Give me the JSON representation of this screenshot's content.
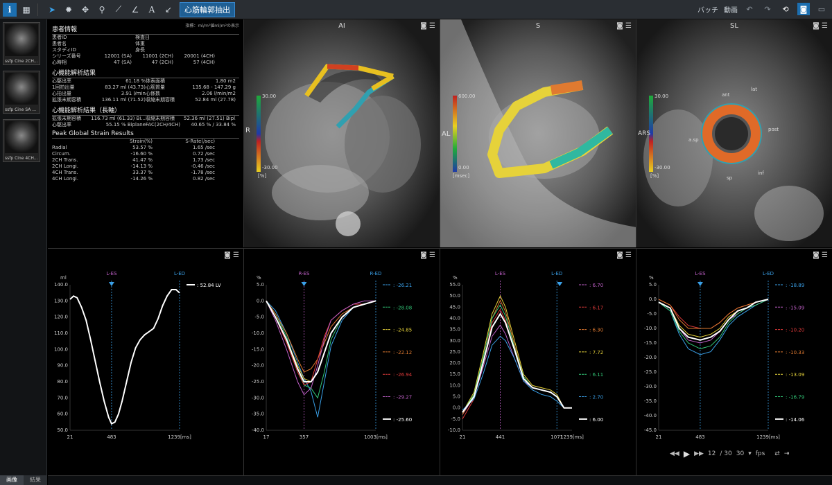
{
  "toolbar": {
    "mode_label": "心筋輪郭抽出",
    "right_labels": [
      "バッチ",
      "動画"
    ]
  },
  "thumbnails": [
    {
      "caption": "ssfp Cine 2CH..."
    },
    {
      "caption": "ssfp Cine SA ..."
    },
    {
      "caption": "ssfp Cine 4CH..."
    }
  ],
  "thumb_tabs": [
    "画像",
    "結果"
  ],
  "info": {
    "title": "患者情報",
    "note": "指標：ml/m²値ml/m²の表示",
    "patient_rows": [
      [
        "患者ID",
        "",
        "検査日",
        ""
      ],
      [
        "患者名",
        "",
        "体重",
        ""
      ],
      [
        "スタディID",
        "",
        "身長",
        ""
      ]
    ],
    "series_row": [
      "シリーズ番号",
      "12001 (SA)",
      "11001 (2CH)",
      "20001 (4CH)"
    ],
    "phase_row": [
      "心時相",
      "47 (SA)",
      "47 (2CH)",
      "57 (4CH)"
    ],
    "cardiac_title": "心機能解析結果",
    "cardiac_rows": [
      [
        "心駆出率",
        "61.18 %",
        "体表面積",
        "1.80 m2"
      ],
      [
        "1回拍出量",
        "83.27 ml (43.73)",
        "心筋質量",
        "135.68 - 147.29 g"
      ],
      [
        "心拍出量",
        "3.91 l/min",
        "心係数",
        "2.06 l/min/m2"
      ],
      [
        "拡張末期容積",
        "136.11 ml (71.52)",
        "収縮末期容積",
        "52.84 ml (27.78)"
      ]
    ],
    "long_title": "心機能解析結果（長軸）",
    "long_rows": [
      [
        "拡張末期容積",
        "116.73 ml (61.33) Bi...",
        "収縮末期容積",
        "52.36 ml (27.51) Bipl..."
      ],
      [
        "心駆出率",
        "55.15 % Biplane",
        "FAC(2CH/4CH)",
        "40.65 % / 33.84 %"
      ]
    ],
    "strain_title": "Peak Global Strain Results",
    "strain_headers": [
      "",
      "Strain(%)",
      "S-Rate(/sec)"
    ],
    "strain_rows": [
      [
        "Radial",
        "53.57 %",
        "1.65 /sec"
      ],
      [
        "Circum.",
        "-16.60 %",
        "0.72 /sec"
      ],
      [
        "2CH Trans.",
        "41.47 %",
        "1.73 /sec"
      ],
      [
        "2CH Longi.",
        "-14.13 %",
        "-0.46 /sec"
      ],
      [
        "4CH Trans.",
        "33.37 %",
        "-1.78 /sec"
      ],
      [
        "4CH Longi.",
        "-14.26 %",
        "0.82 /sec"
      ]
    ]
  },
  "viewports": [
    {
      "title": "AI",
      "axis_label": "R",
      "scale_top": "30.00",
      "scale_bottom": "-30.00",
      "unit": "[%]"
    },
    {
      "title": "S",
      "axis_label": "AL",
      "scale_top": "600.00",
      "scale_bottom": "0.00",
      "unit": "[msec]"
    },
    {
      "title": "SL",
      "axis_label": "ARS",
      "scale_top": "30.00",
      "scale_bottom": "-30.00",
      "unit": "[%]",
      "segments": [
        "ant",
        "lat",
        "post",
        "inf",
        "sp",
        "a.sp"
      ]
    }
  ],
  "chart_data": [
    {
      "type": "line",
      "ylabel": "ml",
      "ylim": [
        50,
        140
      ],
      "yticks": [
        "140.0",
        "130.0",
        "120.0",
        "110.0",
        "100.0",
        "90.0",
        "80.0",
        "70.0",
        "60.0",
        "50.0"
      ],
      "xticks": [
        "21",
        "483",
        "1239[ms]"
      ],
      "markers": [
        "L-ES",
        "L-ED"
      ],
      "series": [
        {
          "name": ": 52.84 LV",
          "color": "#ffffff",
          "x": [
            21,
            60,
            100,
            150,
            200,
            250,
            300,
            350,
            400,
            450,
            483,
            520,
            560,
            600,
            650,
            700,
            750,
            800,
            850,
            900,
            950,
            1000,
            1050,
            1100,
            1150,
            1200,
            1239
          ],
          "y": [
            131,
            133,
            132,
            126,
            118,
            106,
            93,
            80,
            68,
            58,
            54,
            55,
            60,
            68,
            80,
            92,
            101,
            106,
            109,
            111,
            113,
            119,
            127,
            133,
            137,
            137,
            135
          ]
        }
      ]
    },
    {
      "type": "line",
      "ylabel": "%",
      "ylim": [
        -40,
        5
      ],
      "yticks": [
        "5.0",
        "0.0",
        "-5.0",
        "-10.0",
        "-15.0",
        "-20.0",
        "-25.0",
        "-30.0",
        "-35.0",
        "-40.0"
      ],
      "xticks": [
        "17",
        "357",
        "1003[ms]"
      ],
      "markers": [
        "R-ES",
        "R-ED"
      ],
      "series": [
        {
          "name": ": -26.21",
          "color": "#3aa0e8",
          "x": [
            17,
            100,
            200,
            300,
            357,
            420,
            480,
            540,
            600,
            700,
            800,
            900,
            1003
          ],
          "y": [
            0,
            -3,
            -10,
            -19,
            -24,
            -28,
            -36,
            -25,
            -14,
            -6,
            -2,
            -1,
            0
          ]
        },
        {
          "name": ": -28.08",
          "color": "#32c878",
          "x": [
            17,
            100,
            200,
            300,
            357,
            420,
            480,
            540,
            600,
            700,
            800,
            900,
            1003
          ],
          "y": [
            0,
            -4,
            -11,
            -21,
            -26,
            -27,
            -30,
            -22,
            -12,
            -5,
            -2,
            -1,
            0
          ]
        },
        {
          "name": ": -24.85",
          "color": "#e6d23a",
          "x": [
            17,
            100,
            200,
            300,
            357,
            420,
            480,
            540,
            600,
            700,
            800,
            900,
            1003
          ],
          "y": [
            0,
            -5,
            -12,
            -20,
            -24,
            -25,
            -22,
            -16,
            -10,
            -5,
            -2,
            -1,
            0
          ]
        },
        {
          "name": ": -22.12",
          "color": "#e07a30",
          "x": [
            17,
            100,
            200,
            300,
            357,
            420,
            480,
            540,
            600,
            700,
            800,
            900,
            1003
          ],
          "y": [
            0,
            -4,
            -10,
            -18,
            -22,
            -21,
            -18,
            -13,
            -8,
            -4,
            -2,
            -1,
            0
          ]
        },
        {
          "name": ": -26.94",
          "color": "#e03a3a",
          "x": [
            17,
            100,
            200,
            300,
            357,
            420,
            480,
            540,
            600,
            700,
            800,
            900,
            1003
          ],
          "y": [
            0,
            -5,
            -13,
            -22,
            -26,
            -25,
            -18,
            -11,
            -6,
            -3,
            -1,
            -1,
            0
          ]
        },
        {
          "name": ": -29.27",
          "color": "#c060c8",
          "x": [
            17,
            100,
            200,
            300,
            357,
            420,
            480,
            540,
            600,
            700,
            800,
            900,
            1003
          ],
          "y": [
            0,
            -6,
            -15,
            -25,
            -29,
            -27,
            -20,
            -12,
            -6,
            -3,
            -1,
            0,
            0
          ]
        },
        {
          "name": ": -25.60",
          "color": "#ffffff",
          "x": [
            17,
            100,
            200,
            300,
            357,
            420,
            480,
            540,
            600,
            700,
            800,
            900,
            1003
          ],
          "y": [
            0,
            -5,
            -12,
            -21,
            -25,
            -25,
            -22,
            -16,
            -10,
            -5,
            -2,
            -1,
            0
          ]
        }
      ]
    },
    {
      "type": "line",
      "ylabel": "%",
      "ylim": [
        -10,
        55
      ],
      "yticks": [
        "55.0",
        "50.0",
        "45.0",
        "40.0",
        "35.0",
        "30.0",
        "25.0",
        "20.0",
        "15.0",
        "10.0",
        "5.0",
        "0.0",
        "-5.0",
        "-10.0"
      ],
      "xticks": [
        "21",
        "441",
        "1071",
        "1239[ms]"
      ],
      "markers": [
        "L-ES",
        "L-ED"
      ],
      "series": [
        {
          "name": ": 6.70",
          "color": "#c060c8",
          "x": [
            21,
            150,
            250,
            350,
            441,
            500,
            600,
            700,
            800,
            900,
            1000,
            1071,
            1150,
            1239
          ],
          "y": [
            -3,
            5,
            18,
            32,
            37,
            33,
            22,
            12,
            9,
            8,
            7,
            5,
            0,
            0
          ]
        },
        {
          "name": ": 6.17",
          "color": "#e03a3a",
          "x": [
            21,
            150,
            250,
            350,
            441,
            500,
            600,
            700,
            800,
            900,
            1000,
            1071,
            1150,
            1239
          ],
          "y": [
            -5,
            4,
            20,
            38,
            44,
            39,
            26,
            14,
            9,
            8,
            7,
            5,
            0,
            0
          ]
        },
        {
          "name": ": 6.30",
          "color": "#e07a30",
          "x": [
            21,
            150,
            250,
            350,
            441,
            500,
            600,
            700,
            800,
            900,
            1000,
            1071,
            1150,
            1239
          ],
          "y": [
            -3,
            6,
            22,
            40,
            48,
            43,
            28,
            14,
            9,
            8,
            7,
            5,
            0,
            0
          ]
        },
        {
          "name": ": 7.72",
          "color": "#e6d23a",
          "x": [
            21,
            150,
            250,
            350,
            441,
            500,
            600,
            700,
            800,
            900,
            1000,
            1071,
            1150,
            1239
          ],
          "y": [
            -2,
            7,
            24,
            42,
            50,
            45,
            30,
            15,
            10,
            9,
            8,
            6,
            0,
            0
          ]
        },
        {
          "name": ": 6.11",
          "color": "#32c878",
          "x": [
            21,
            150,
            250,
            350,
            441,
            500,
            600,
            700,
            800,
            900,
            1000,
            1071,
            1150,
            1239
          ],
          "y": [
            -2,
            6,
            22,
            40,
            46,
            41,
            27,
            14,
            9,
            8,
            7,
            5,
            0,
            0
          ]
        },
        {
          "name": ": 2.70",
          "color": "#3aa0e8",
          "x": [
            21,
            150,
            250,
            350,
            441,
            500,
            600,
            700,
            800,
            900,
            1000,
            1071,
            1150,
            1239
          ],
          "y": [
            -1,
            4,
            15,
            28,
            32,
            30,
            22,
            12,
            8,
            6,
            5,
            3,
            0,
            0
          ]
        },
        {
          "name": ": 6.00",
          "color": "#ffffff",
          "x": [
            21,
            150,
            250,
            350,
            441,
            500,
            600,
            700,
            800,
            900,
            1000,
            1071,
            1150,
            1239
          ],
          "y": [
            -2,
            5,
            20,
            36,
            42,
            38,
            26,
            13,
            9,
            8,
            7,
            5,
            0,
            0
          ]
        }
      ]
    },
    {
      "type": "line",
      "ylabel": "%",
      "ylim": [
        -45,
        5
      ],
      "yticks": [
        "5.0",
        "0.0",
        "-5.0",
        "-10.0",
        "-15.0",
        "-20.0",
        "-25.0",
        "-30.0",
        "-35.0",
        "-40.0",
        "-45.0"
      ],
      "xticks": [
        "21",
        "483",
        "1239[ms]"
      ],
      "markers": [
        "L-ES",
        "L-ED"
      ],
      "series": [
        {
          "name": ": -18.89",
          "color": "#3aa0e8",
          "x": [
            21,
            150,
            250,
            350,
            483,
            600,
            700,
            800,
            900,
            1000,
            1100,
            1239
          ],
          "y": [
            -1,
            -4,
            -12,
            -17,
            -19,
            -18,
            -14,
            -9,
            -6,
            -4,
            -2,
            0
          ]
        },
        {
          "name": ": -15.09",
          "color": "#c060c8",
          "x": [
            21,
            150,
            250,
            350,
            483,
            600,
            700,
            800,
            900,
            1000,
            1100,
            1239
          ],
          "y": [
            -1,
            -3,
            -10,
            -14,
            -15,
            -14,
            -11,
            -7,
            -5,
            -3,
            -2,
            0
          ]
        },
        {
          "name": ": -10.20",
          "color": "#e03a3a",
          "x": [
            21,
            150,
            250,
            350,
            483,
            600,
            700,
            800,
            900,
            1000,
            1100,
            1239
          ],
          "y": [
            0,
            -2,
            -6,
            -9,
            -10,
            -10,
            -8,
            -5,
            -3,
            -2,
            -1,
            0
          ]
        },
        {
          "name": ": -10.33",
          "color": "#e07a30",
          "x": [
            21,
            150,
            250,
            350,
            483,
            600,
            700,
            800,
            900,
            1000,
            1100,
            1239
          ],
          "y": [
            0,
            -2,
            -7,
            -10,
            -10,
            -10,
            -8,
            -5,
            -3,
            -2,
            -1,
            0
          ]
        },
        {
          "name": ": -13.09",
          "color": "#e6d23a",
          "x": [
            21,
            150,
            250,
            350,
            483,
            600,
            700,
            800,
            900,
            1000,
            1100,
            1239
          ],
          "y": [
            -1,
            -3,
            -9,
            -12,
            -13,
            -12,
            -10,
            -6,
            -4,
            -3,
            -1,
            0
          ]
        },
        {
          "name": ": -16.79",
          "color": "#32c878",
          "x": [
            21,
            150,
            250,
            350,
            483,
            600,
            700,
            800,
            900,
            1000,
            1100,
            1239
          ],
          "y": [
            -1,
            -4,
            -11,
            -15,
            -17,
            -16,
            -13,
            -8,
            -5,
            -3,
            -2,
            0
          ]
        },
        {
          "name": ": -14.06",
          "color": "#ffffff",
          "x": [
            21,
            150,
            250,
            350,
            483,
            600,
            700,
            800,
            900,
            1000,
            1100,
            1239
          ],
          "y": [
            -1,
            -3,
            -10,
            -13,
            -14,
            -13,
            -11,
            -7,
            -4,
            -3,
            -1,
            0
          ]
        }
      ]
    }
  ],
  "player": {
    "frame": "12",
    "total": "/ 30",
    "fps": "30",
    "fps_label": "fps"
  }
}
